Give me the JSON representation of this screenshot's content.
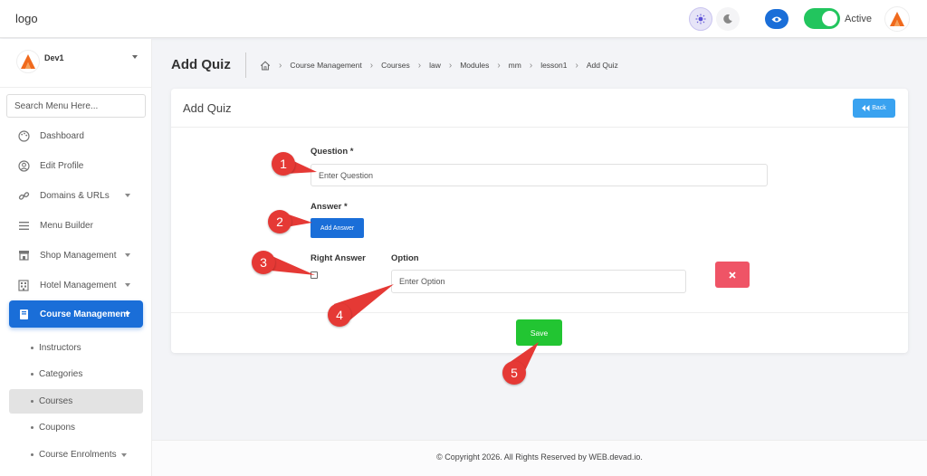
{
  "topbar": {
    "logo": "logo",
    "status_label": "Active"
  },
  "sidebar": {
    "user": "Dev1",
    "search_placeholder": "Search Menu Here...",
    "items": [
      {
        "label": "Dashboard",
        "icon": "palette-icon"
      },
      {
        "label": "Edit Profile",
        "icon": "user-circle-icon"
      },
      {
        "label": "Domains & URLs",
        "icon": "link-icon"
      },
      {
        "label": "Menu Builder",
        "icon": "menu-icon"
      },
      {
        "label": "Shop Management",
        "icon": "store-icon"
      },
      {
        "label": "Hotel Management",
        "icon": "hotel-icon"
      },
      {
        "label": "Course Management",
        "icon": "book-icon"
      }
    ],
    "sub_items": [
      {
        "label": "Instructors"
      },
      {
        "label": "Categories"
      },
      {
        "label": "Courses"
      },
      {
        "label": "Coupons"
      },
      {
        "label": "Course Enrolments"
      }
    ]
  },
  "page": {
    "title": "Add Quiz",
    "breadcrumb": [
      "Course Management",
      "Courses",
      "law",
      "Modules",
      "mm",
      "lesson1",
      "Add Quiz"
    ]
  },
  "card": {
    "title": "Add Quiz",
    "back_label": "Back",
    "question_label": "Question *",
    "question_placeholder": "Enter Question",
    "answer_label": "Answer *",
    "add_answer_label": "Add Answer",
    "right_answer_label": "Right Answer",
    "option_label": "Option",
    "option_placeholder": "Enter Option",
    "save_label": "Save"
  },
  "annotations": [
    "1",
    "2",
    "3",
    "4",
    "5"
  ],
  "footer": {
    "copyright": "© Copyright 2026. All Rights Reserved by WEB.devad.io."
  },
  "colors": {
    "primary": "#1a6ed8",
    "success": "#22c532",
    "danger": "#ef5466",
    "info": "#39a2f0",
    "marker": "#e53935"
  }
}
